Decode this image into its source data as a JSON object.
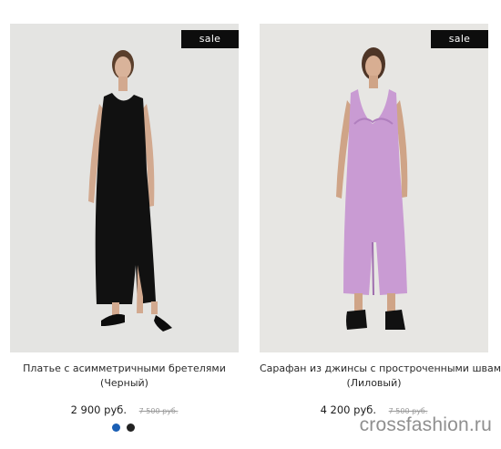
{
  "products": [
    {
      "badge": "sale",
      "title_line1": "Платье с асимметричными бретелями",
      "title_line2": "(Черный)",
      "price": "2 900 руб.",
      "old_price": "7 500 руб.",
      "dress_color": "#111111"
    },
    {
      "badge": "sale",
      "title_line1": "Сарафан из джинсы с простроченными швами",
      "title_line2": "(Лиловый)",
      "price": "4 200 руб.",
      "old_price": "7 500 руб.",
      "dress_color": "#c79bd1"
    }
  ],
  "swatches": [
    {
      "color": "#1a5fb4",
      "selected": true
    },
    {
      "color": "#222222",
      "selected": false
    }
  ],
  "watermark": "crossfashion.ru"
}
